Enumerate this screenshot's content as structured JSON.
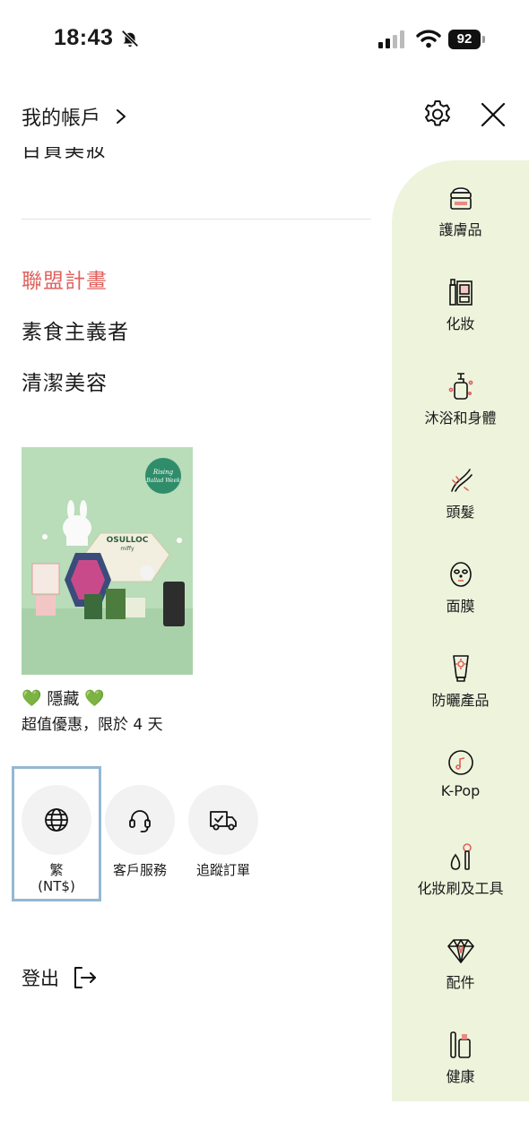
{
  "status_bar": {
    "time": "18:43",
    "battery": "92"
  },
  "header": {
    "title": "我的帳戶"
  },
  "menu": {
    "clipped_text": "百貨美妝",
    "links": [
      "聯盟計畫",
      "素食主義者",
      "清潔美容"
    ]
  },
  "promo": {
    "badge_text": "Rising Ballad Week",
    "brand": "OSULLOC",
    "collab": "miffy",
    "title": "隱藏",
    "emoji": "💚",
    "subtitle": "超值優惠，限於 4 天"
  },
  "quick_actions": [
    {
      "label": "繁\n(NT$)",
      "icon": "globe-icon"
    },
    {
      "label": "客戶服務",
      "icon": "headset-icon"
    },
    {
      "label": "追蹤訂單",
      "icon": "truck-icon"
    }
  ],
  "logout": {
    "label": "登出"
  },
  "categories": [
    {
      "label": "護膚品",
      "icon": "cream-jar-icon"
    },
    {
      "label": "化妝",
      "icon": "makeup-icon"
    },
    {
      "label": "沐浴和身體",
      "icon": "pump-bottle-icon"
    },
    {
      "label": "頭髮",
      "icon": "hair-icon"
    },
    {
      "label": "面膜",
      "icon": "face-mask-icon"
    },
    {
      "label": "防曬產品",
      "icon": "sunscreen-icon"
    },
    {
      "label": "K-Pop",
      "icon": "music-disc-icon"
    },
    {
      "label": "化妝刷及工具",
      "icon": "brush-tools-icon"
    },
    {
      "label": "配件",
      "icon": "diamond-icon"
    },
    {
      "label": "健康",
      "icon": "health-icon"
    }
  ],
  "colors": {
    "accent": "#e0625d",
    "rail_bg": "#eef3dc",
    "focus_outline": "#94b8d2"
  }
}
